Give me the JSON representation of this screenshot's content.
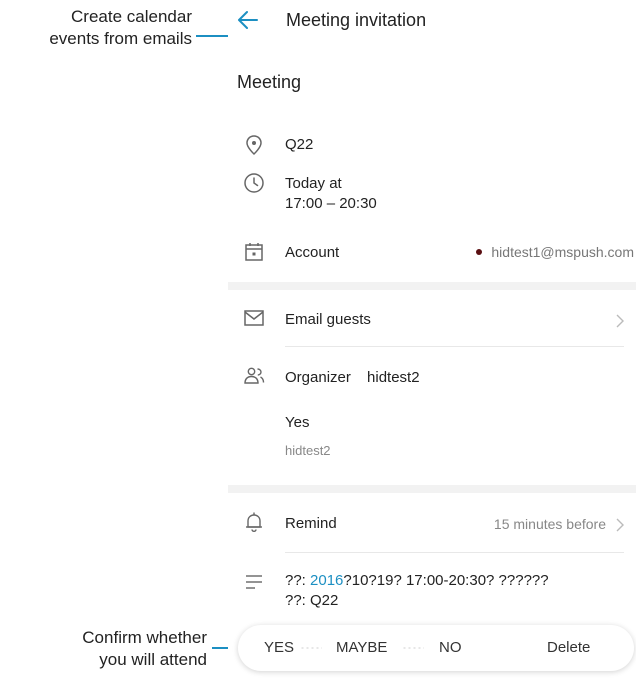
{
  "callouts": {
    "top_line1": "Create calendar",
    "top_line2": "events from emails",
    "bottom_line1": "Confirm whether",
    "bottom_line2": "you will attend"
  },
  "header": {
    "back_icon": "arrow-left-icon",
    "title": "Meeting invitation"
  },
  "meeting": {
    "title": "Meeting"
  },
  "location": {
    "icon": "location-pin-icon",
    "value": "Q22"
  },
  "time": {
    "icon": "clock-icon",
    "line1": "Today at",
    "line2": "17:00 – 20:30"
  },
  "account": {
    "icon": "calendar-icon",
    "label": "Account",
    "email": "hidtest1@mspush.com",
    "dot_color": "#5a0f12"
  },
  "email_guests": {
    "icon": "envelope-icon",
    "label": "Email guests"
  },
  "organizer": {
    "icon": "people-icon",
    "label": "Organizer",
    "name": "hidtest2"
  },
  "response": {
    "status": "Yes",
    "name": "hidtest2"
  },
  "remind": {
    "icon": "bell-icon",
    "label": "Remind",
    "value": "15 minutes before"
  },
  "description": {
    "icon": "notes-icon",
    "line1_prefix": "??: ",
    "line1_link": "2016",
    "line1_suffix": "?10?19? 17:00-20:30? ??????",
    "line2": "??: Q22"
  },
  "actions": {
    "yes": "YES",
    "maybe": "MAYBE",
    "no": "NO",
    "delete": "Delete"
  },
  "colors": {
    "accent": "#1c8fc2",
    "divider": "#f2f2f2"
  }
}
